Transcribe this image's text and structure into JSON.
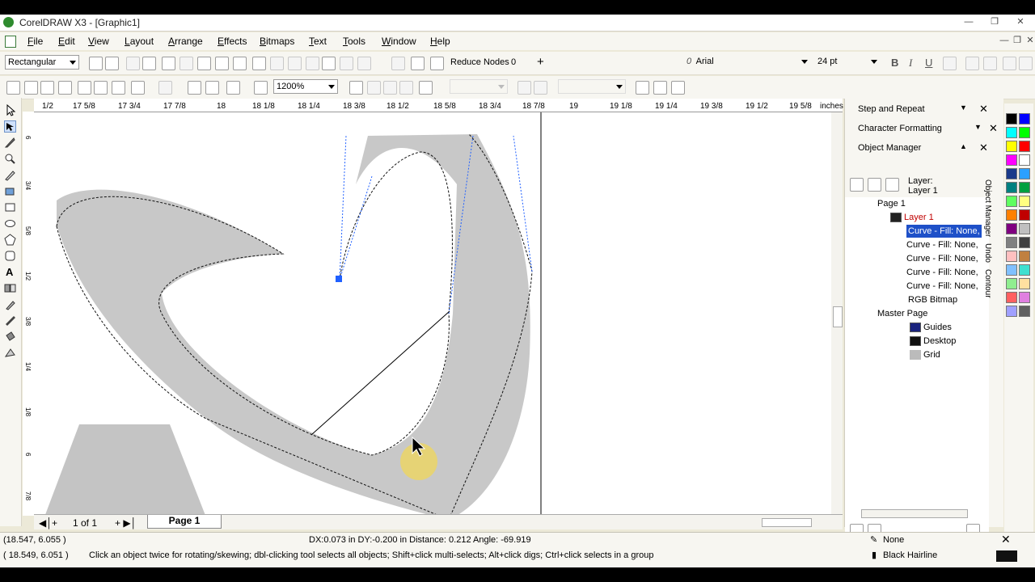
{
  "window": {
    "title": "CorelDRAW X3 - [Graphic1]"
  },
  "menu": [
    "File",
    "Edit",
    "View",
    "Layout",
    "Arrange",
    "Effects",
    "Bitmaps",
    "Text",
    "Tools",
    "Window",
    "Help"
  ],
  "property_bar": {
    "selection_mode": "Rectangular",
    "reduce_nodes_label": "Reduce Nodes",
    "reduce_nodes_value": "0",
    "font": "Arial",
    "font_size": "24 pt"
  },
  "standard_bar": {
    "zoom": "1200%"
  },
  "ruler": {
    "top_ticks": [
      "1/2",
      "17 5/8",
      "17 3/4",
      "17 7/8",
      "18",
      "18 1/8",
      "18 1/4",
      "18 3/8",
      "18 1/2",
      "18 5/8",
      "18 3/4",
      "18 7/8",
      "19",
      "19 1/8",
      "19 1/4",
      "19 3/8",
      "19 1/2",
      "19 5/8",
      "inches"
    ],
    "left_ticks": [
      "6",
      "3/4",
      "5/8",
      "1/2",
      "3/8",
      "1/4",
      "1/8",
      "6",
      "7/8"
    ]
  },
  "page_nav": {
    "count": "1 of 1",
    "tab": "Page 1"
  },
  "dockers": {
    "step_repeat": "Step and Repeat",
    "char_formatting": "Character Formatting",
    "object_manager": "Object Manager",
    "layer_label": "Layer:",
    "layer_name": "Layer 1",
    "tree": [
      {
        "label": "Page 1",
        "indent": 0
      },
      {
        "label": "Layer 1",
        "indent": 1,
        "color": "#c00000"
      },
      {
        "label": "Curve - Fill: None,",
        "indent": 2,
        "selected": true
      },
      {
        "label": "Curve - Fill: None,",
        "indent": 2
      },
      {
        "label": "Curve - Fill: None,",
        "indent": 2
      },
      {
        "label": "Curve - Fill: None,",
        "indent": 2
      },
      {
        "label": "Curve - Fill: None,",
        "indent": 2
      },
      {
        "label": "RGB Bitmap",
        "indent": 2
      },
      {
        "label": "Master Page",
        "indent": 0
      },
      {
        "label": "Guides",
        "indent": 1
      },
      {
        "label": "Desktop",
        "indent": 1
      },
      {
        "label": "Grid",
        "indent": 1
      }
    ],
    "side_tabs": [
      "Object Manager",
      "Undo",
      "Contour"
    ]
  },
  "palette": [
    "#000000",
    "#0000ff",
    "#00ffff",
    "#00ff00",
    "#ffff00",
    "#ff0000",
    "#ff00ff",
    "#ffffff",
    "#1a3a8a",
    "#2aa0ff",
    "#008080",
    "#00a040",
    "#60ff60",
    "#ffff80",
    "#ff8000",
    "#c00000",
    "#800080",
    "#c0c0c0",
    "#808080",
    "#404040",
    "#ffc0c0",
    "#c08040",
    "#80c0ff",
    "#40e0d0",
    "#90ee90",
    "#ffe0a0",
    "#ff6060",
    "#e080e0",
    "#a0a0ff",
    "#606060"
  ],
  "status": {
    "coords1": "(18.547, 6.055 )",
    "coords2": "( 18.549, 6.051 )",
    "measure": "DX:0.073 in DY:-0.200 in Distance: 0.212 Angle: -69.919",
    "hint": "Click an object twice for rotating/skewing; dbl-clicking tool selects all objects; Shift+click multi-selects; Alt+click digs; Ctrl+click selects in a group",
    "fill": "None",
    "outline": "Black  Hairline"
  }
}
